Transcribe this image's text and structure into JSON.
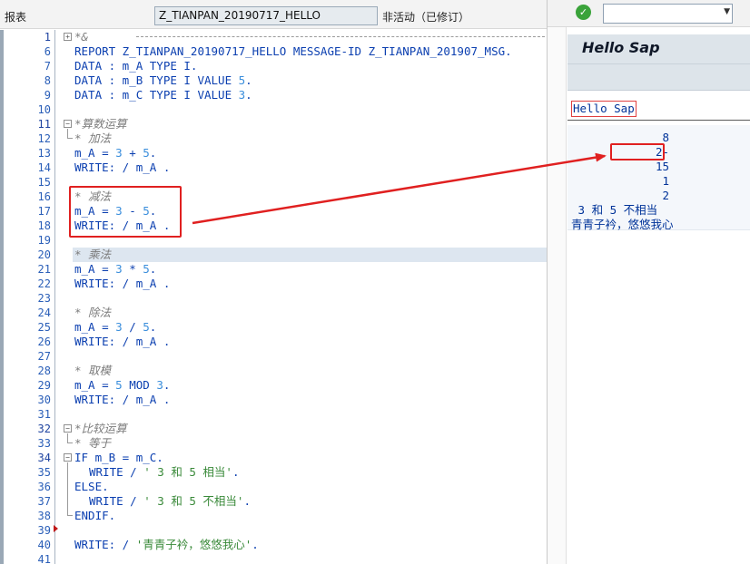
{
  "editor": {
    "header": {
      "type_label": "报表",
      "program_name": "Z_TIANPAN_20190717_HELLO",
      "status": "非活动（已修订）"
    },
    "lines": [
      {
        "n": "1",
        "fold": "+",
        "tokens": [
          {
            "t": "*&",
            "c": "cm"
          }
        ]
      },
      {
        "n": "6",
        "tokens": [
          {
            "t": "REPORT Z_TIANPAN_20190717_HELLO MESSAGE-ID Z_TIANPAN_201907_MSG.",
            "c": "kw"
          }
        ]
      },
      {
        "n": "7",
        "tokens": [
          {
            "t": "DATA : m_A TYPE I.",
            "c": "kw"
          }
        ]
      },
      {
        "n": "8",
        "tokens": [
          {
            "t": "DATA : m_B TYPE I VALUE ",
            "c": "kw"
          },
          {
            "t": "5",
            "c": "nm"
          },
          {
            "t": ".",
            "c": "kw"
          }
        ]
      },
      {
        "n": "9",
        "tokens": [
          {
            "t": "DATA : m_C TYPE I VALUE ",
            "c": "kw"
          },
          {
            "t": "3",
            "c": "nm"
          },
          {
            "t": ".",
            "c": "kw"
          }
        ]
      },
      {
        "n": "10",
        "tokens": []
      },
      {
        "n": "11",
        "fold": "-",
        "tokens": [
          {
            "t": "*算数运算",
            "c": "cm"
          }
        ]
      },
      {
        "n": "12",
        "tokens": [
          {
            "t": "* 加法",
            "c": "cm"
          }
        ]
      },
      {
        "n": "13",
        "tokens": [
          {
            "t": "m_A = ",
            "c": "kw"
          },
          {
            "t": "3",
            "c": "nm"
          },
          {
            "t": " + ",
            "c": "kw"
          },
          {
            "t": "5",
            "c": "nm"
          },
          {
            "t": ".",
            "c": "kw"
          }
        ]
      },
      {
        "n": "14",
        "tokens": [
          {
            "t": "WRITE: / m_A .",
            "c": "kw"
          }
        ]
      },
      {
        "n": "15",
        "tokens": []
      },
      {
        "n": "16",
        "tokens": [
          {
            "t": "* 减法",
            "c": "cm"
          }
        ]
      },
      {
        "n": "17",
        "tokens": [
          {
            "t": "m_A = ",
            "c": "kw"
          },
          {
            "t": "3",
            "c": "nm"
          },
          {
            "t": " - ",
            "c": "kw"
          },
          {
            "t": "5",
            "c": "nm"
          },
          {
            "t": ".",
            "c": "kw"
          }
        ]
      },
      {
        "n": "18",
        "tokens": [
          {
            "t": "WRITE: / m_A .",
            "c": "kw"
          }
        ]
      },
      {
        "n": "19",
        "tokens": []
      },
      {
        "n": "20",
        "hl": true,
        "tokens": [
          {
            "t": "* 乘法",
            "c": "cm"
          }
        ]
      },
      {
        "n": "21",
        "tokens": [
          {
            "t": "m_A = ",
            "c": "kw"
          },
          {
            "t": "3",
            "c": "nm"
          },
          {
            "t": " * ",
            "c": "kw"
          },
          {
            "t": "5",
            "c": "nm"
          },
          {
            "t": ".",
            "c": "kw"
          }
        ]
      },
      {
        "n": "22",
        "tokens": [
          {
            "t": "WRITE: / m_A .",
            "c": "kw"
          }
        ]
      },
      {
        "n": "23",
        "tokens": []
      },
      {
        "n": "24",
        "tokens": [
          {
            "t": "* 除法",
            "c": "cm"
          }
        ]
      },
      {
        "n": "25",
        "tokens": [
          {
            "t": "m_A = ",
            "c": "kw"
          },
          {
            "t": "3",
            "c": "nm"
          },
          {
            "t": " / ",
            "c": "kw"
          },
          {
            "t": "5",
            "c": "nm"
          },
          {
            "t": ".",
            "c": "kw"
          }
        ]
      },
      {
        "n": "26",
        "tokens": [
          {
            "t": "WRITE: / m_A .",
            "c": "kw"
          }
        ]
      },
      {
        "n": "27",
        "tokens": []
      },
      {
        "n": "28",
        "tokens": [
          {
            "t": "* 取模",
            "c": "cm"
          }
        ]
      },
      {
        "n": "29",
        "tokens": [
          {
            "t": "m_A = ",
            "c": "kw"
          },
          {
            "t": "5",
            "c": "nm"
          },
          {
            "t": " MOD ",
            "c": "kw"
          },
          {
            "t": "3",
            "c": "nm"
          },
          {
            "t": ".",
            "c": "kw"
          }
        ]
      },
      {
        "n": "30",
        "tokens": [
          {
            "t": "WRITE: / m_A .",
            "c": "kw"
          }
        ]
      },
      {
        "n": "31",
        "tokens": []
      },
      {
        "n": "32",
        "fold": "-",
        "tokens": [
          {
            "t": "*比较运算",
            "c": "cm"
          }
        ]
      },
      {
        "n": "33",
        "tokens": [
          {
            "t": "* 等于",
            "c": "cm"
          }
        ]
      },
      {
        "n": "34",
        "fold": "-",
        "tokens": [
          {
            "t": "IF m_B = m_C.",
            "c": "kw"
          }
        ]
      },
      {
        "n": "35",
        "indent": true,
        "tokens": [
          {
            "t": "WRITE / ",
            "c": "kw"
          },
          {
            "t": "' 3 和 5 相当'",
            "c": "st"
          },
          {
            "t": ".",
            "c": "kw"
          }
        ]
      },
      {
        "n": "36",
        "tokens": [
          {
            "t": "ELSE.",
            "c": "kw"
          }
        ]
      },
      {
        "n": "37",
        "indent": true,
        "tokens": [
          {
            "t": "WRITE / ",
            "c": "kw"
          },
          {
            "t": "' 3 和 5 不相当'",
            "c": "st"
          },
          {
            "t": ".",
            "c": "kw"
          }
        ]
      },
      {
        "n": "38",
        "tokens": [
          {
            "t": "ENDIF.",
            "c": "kw"
          }
        ]
      },
      {
        "n": "39",
        "tokens": []
      },
      {
        "n": "40",
        "tokens": [
          {
            "t": "WRITE: / ",
            "c": "kw"
          },
          {
            "t": "'青青子衿，悠悠我心'",
            "c": "st"
          },
          {
            "t": ".",
            "c": "kw"
          }
        ]
      },
      {
        "n": "41",
        "tokens": []
      }
    ]
  },
  "output": {
    "window_title": "Hello Sap",
    "list_header": "Hello Sap",
    "values": [
      "8",
      "2-",
      "15",
      "1",
      "2"
    ],
    "texts": [
      " 3 和 5 不相当",
      "青青子衿，悠悠我心"
    ]
  },
  "annotation_color": "#e02020"
}
